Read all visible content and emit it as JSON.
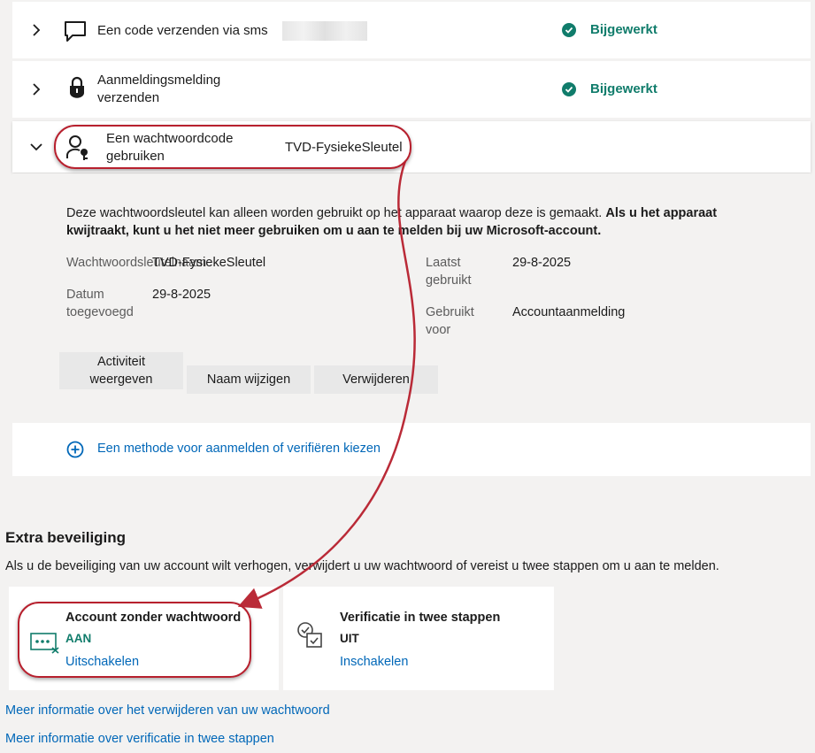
{
  "methods": [
    {
      "title": "Een code verzenden via sms",
      "status": "Bijgewerkt",
      "chevron": "chevron-right-icon",
      "icon": "chat-icon"
    },
    {
      "title_line1": "Aanmeldingsmelding",
      "title_line2": "verzenden",
      "status": "Bijgewerkt",
      "chevron": "chevron-right-icon",
      "icon": "lock-icon"
    }
  ],
  "passkey": {
    "title_line1": "Een wachtwoordcode",
    "title_line2": "gebruiken",
    "name": "TVD-FysiekeSleutel",
    "description_normal": "Deze wachtwoordsleutel kan alleen worden gebruikt op het apparaat waarop deze is gemaakt. ",
    "description_bold": "Als u het apparaat kwijtraakt, kunt u het niet meer gebruiken om u aan te melden bij uw Microsoft-account.",
    "label_name": "Wachtwoordsleutelnaam",
    "value_name": "TVD-FysiekeSleutel",
    "label_added_1": "Datum",
    "label_added_2": "toegevoegd",
    "value_added": "29-8-2025",
    "label_last_1": "Laatst",
    "label_last_2": "gebruikt",
    "value_last": "29-8-2025",
    "label_used_1": "Gebruikt",
    "label_used_2": "voor",
    "value_used": "Accountaanmelding",
    "btn_activity_1": "Activiteit",
    "btn_activity_2": "weergeven",
    "btn_rename": "Naam wijzigen",
    "btn_delete": "Verwijderen"
  },
  "add_method": "Een methode voor aanmelden of verifiëren kiezen",
  "extra": {
    "heading": "Extra beveiliging",
    "intro": "Als u de beveiliging van uw account wilt verhogen, verwijdert u uw wachtwoord of vereist u twee stappen om u aan te melden.",
    "passwordless": {
      "title": "Account zonder wachtwoord",
      "state": "AAN",
      "action": "Uitschakelen"
    },
    "twostep": {
      "title": "Verificatie in twee stappen",
      "state": "UIT",
      "action": "Inschakelen"
    }
  },
  "links": {
    "remove_password": "Meer informatie over het verwijderen van uw wachtwoord",
    "two_step": "Meer informatie over verificatie in twee stappen"
  },
  "colors": {
    "accent_green": "#107c6b",
    "link_blue": "#0067b8",
    "annotation_red": "#b7202e"
  }
}
